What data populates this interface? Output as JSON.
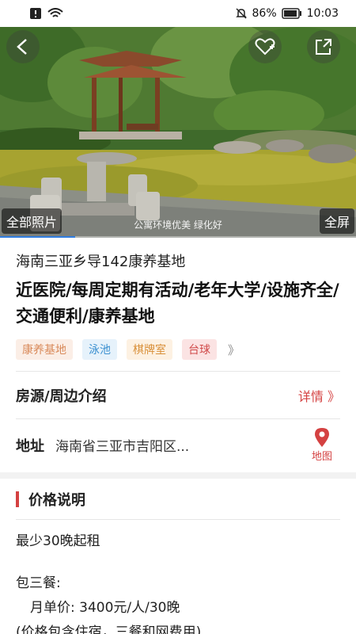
{
  "status_bar": {
    "battery": "86%",
    "time": "10:03"
  },
  "hero": {
    "all_photos": "全部照片",
    "fullscreen": "全屏",
    "caption": "公寓环境优美 绿化好",
    "progress": 0.21
  },
  "listing": {
    "subtitle": "海南三亚乡导142康养基地",
    "title": "近医院/每周定期有活动/老年大学/设施齐全/交通便利/康养基地",
    "tags": [
      {
        "label": "康养基地",
        "color": "#d98a5a",
        "bg": "#fbeee6"
      },
      {
        "label": "泳池",
        "color": "#3a8fd0",
        "bg": "#e6f2fb"
      },
      {
        "label": "棋牌室",
        "color": "#d9903a",
        "bg": "#fdf1e2"
      },
      {
        "label": "台球",
        "color": "#d04b4b",
        "bg": "#fbe3e3"
      }
    ],
    "tags_more": "》"
  },
  "house": {
    "label": "房源/周边介绍",
    "detail": "详情 》"
  },
  "address": {
    "label": "地址",
    "value": "海南省三亚市吉阳区...",
    "map_label": "地图"
  },
  "price": {
    "title": "价格说明",
    "min_stay": "最少30晚起租",
    "meals": "包三餐:",
    "monthly": "月单价:  3400元/人/30晚",
    "note": "(价格包含住宿，三餐和网费用)"
  },
  "colors": {
    "accent": "#d44141",
    "progress": "#2f7de1"
  }
}
